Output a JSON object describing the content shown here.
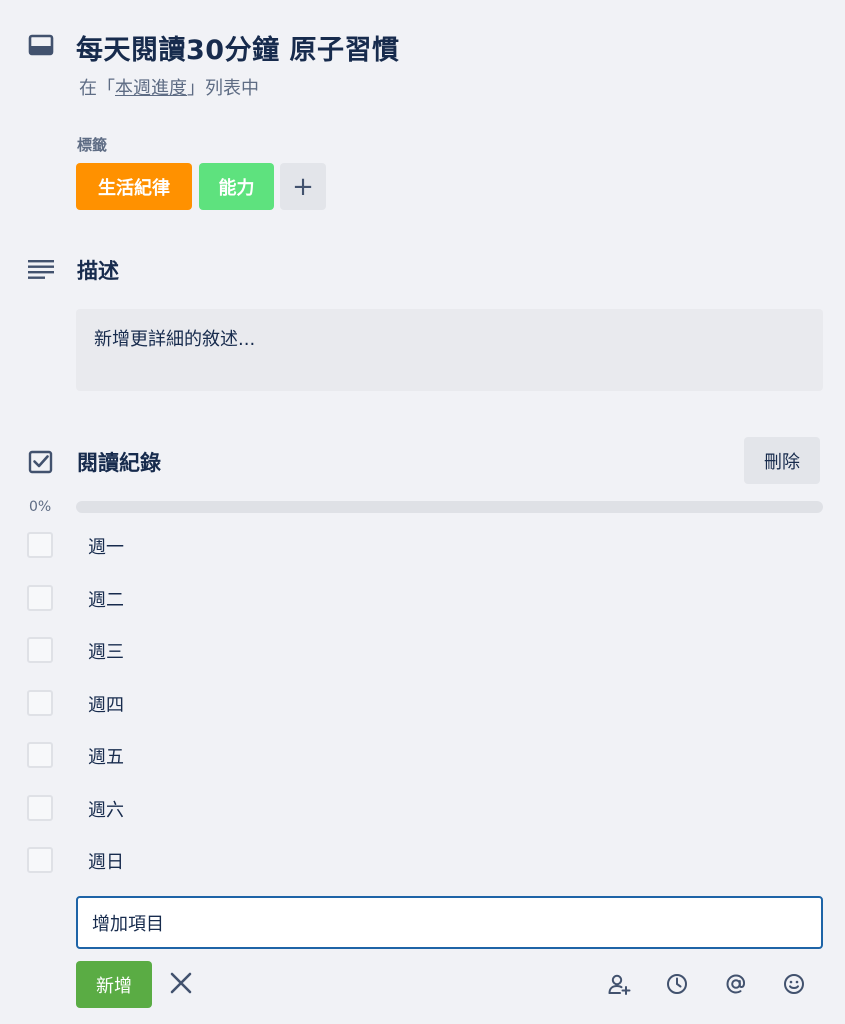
{
  "card": {
    "title": "每天閱讀30分鐘 原子習慣",
    "list_prefix": "在「",
    "list_name": "本週進度",
    "list_suffix": "」列表中"
  },
  "labels": {
    "heading": "標籤",
    "items": [
      {
        "text": "生活紀律",
        "color": "#ff9100"
      },
      {
        "text": "能力",
        "color": "#5ee27e"
      }
    ],
    "add_label": "+"
  },
  "description": {
    "heading": "描述",
    "placeholder": "新增更詳細的敘述..."
  },
  "checklist": {
    "heading": "閱讀紀錄",
    "delete_label": "刪除",
    "progress_text": "0%",
    "progress_value": 0,
    "items": [
      {
        "text": "週一",
        "checked": false
      },
      {
        "text": "週二",
        "checked": false
      },
      {
        "text": "週三",
        "checked": false
      },
      {
        "text": "週四",
        "checked": false
      },
      {
        "text": "週五",
        "checked": false
      },
      {
        "text": "週六",
        "checked": false
      },
      {
        "text": "週日",
        "checked": false
      }
    ],
    "add_item_value": "增加項目",
    "add_button_label": "新增"
  },
  "colors": {
    "accent_green": "#5aac44",
    "input_border": "#1e64a7",
    "text_primary": "#172b4d",
    "text_muted": "#5e6c84"
  },
  "icons": [
    "card-icon",
    "description-icon",
    "checklist-icon",
    "close-icon",
    "assign-member-icon",
    "due-date-icon",
    "mention-icon",
    "emoji-icon"
  ]
}
